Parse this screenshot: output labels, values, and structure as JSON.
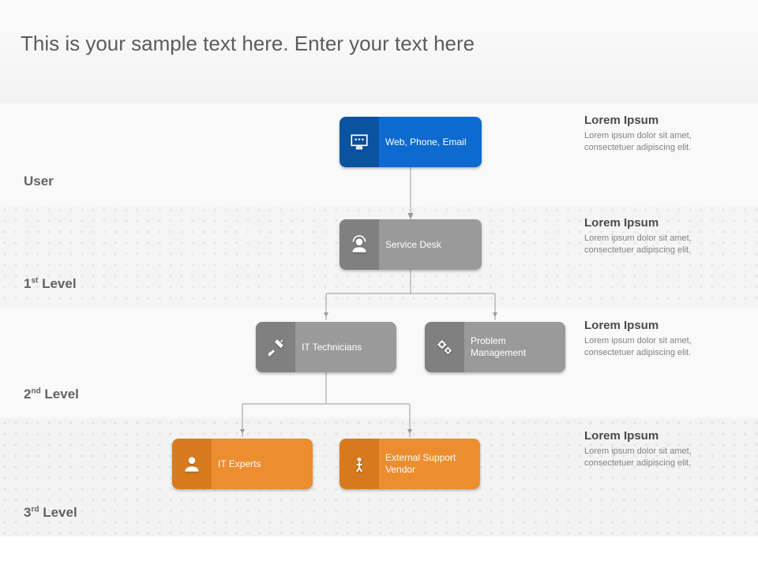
{
  "title": "This is your sample text here. Enter your text here",
  "rows": {
    "user": {
      "label_html": "User"
    },
    "l1": {
      "label_html": "1<sup>st</sup> Level"
    },
    "l2": {
      "label_html": "2<sup>nd</sup> Level"
    },
    "l3": {
      "label_html": "3<sup>rd</sup> Level"
    }
  },
  "nodes": {
    "n1": {
      "label": "Web, Phone, Email"
    },
    "n2": {
      "label": "Service Desk"
    },
    "n3": {
      "label": "IT Technicians"
    },
    "n4": {
      "label": "Problem Management"
    },
    "n5": {
      "label": "IT Experts"
    },
    "n6": {
      "label": "External Support Vendor"
    }
  },
  "side": {
    "s1": {
      "h": "Lorem Ipsum",
      "p": "Lorem ipsum dolor sit amet, consectetuer adipiscing elit."
    },
    "s2": {
      "h": "Lorem Ipsum",
      "p": "Lorem ipsum dolor sit amet, consectetuer adipiscing elit."
    },
    "s3": {
      "h": "Lorem Ipsum",
      "p": "Lorem ipsum dolor sit amet, consectetuer adipiscing elit."
    },
    "s4": {
      "h": "Lorem Ipsum",
      "p": "Lorem ipsum dolor sit amet, consectetuer adipiscing elit."
    }
  },
  "colors": {
    "blue": "#0d6bcf",
    "gray": "#9a9a9a",
    "orange": "#ec8d2f"
  }
}
